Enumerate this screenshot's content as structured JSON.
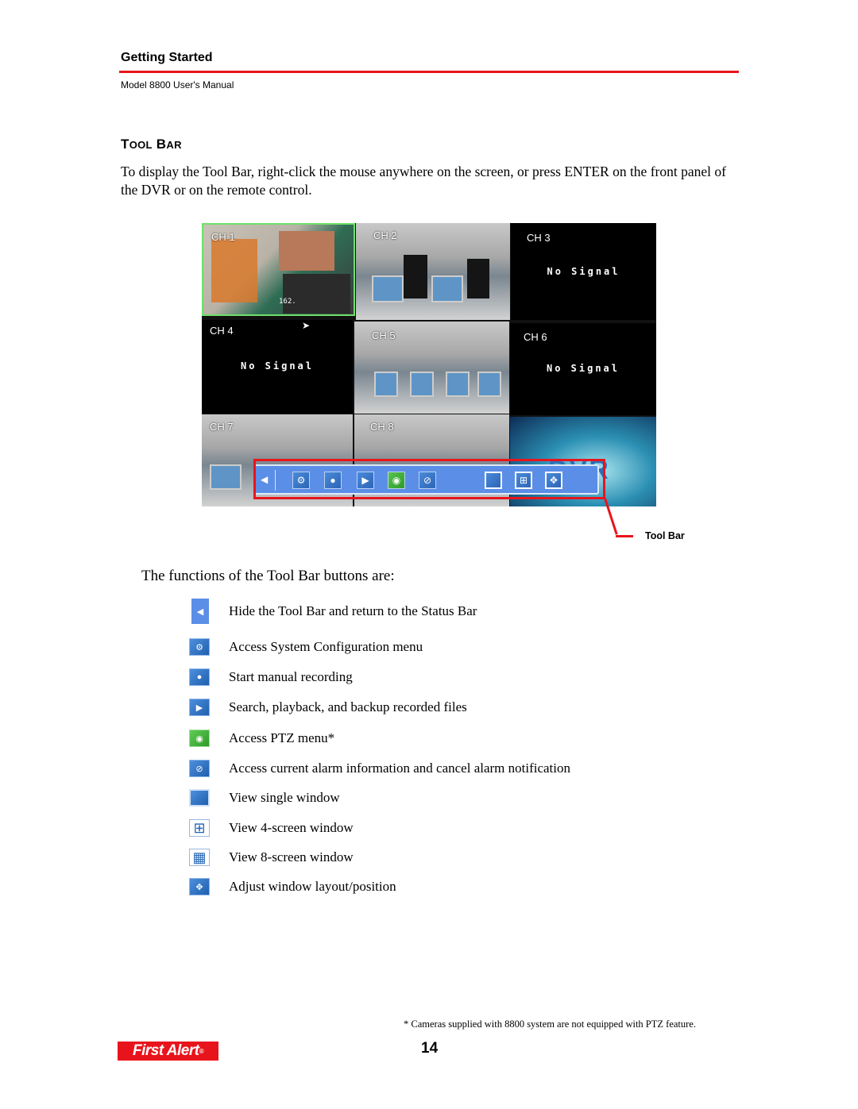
{
  "header": {
    "section": "Getting Started",
    "manual": "Model 8800 User's Manual",
    "rule_color": "#e8141c"
  },
  "section_title": {
    "first_cap": "T",
    "first_rest": "OOL",
    "second_cap": "B",
    "second_rest": "AR"
  },
  "intro": "To display the Tool Bar, right-click the mouse anywhere on the screen, or press ENTER on the front panel of the DVR or on the remote control.",
  "dvr_screen": {
    "channels": [
      {
        "label": "CH 1",
        "status": "video"
      },
      {
        "label": "CH 2",
        "status": "video"
      },
      {
        "label": "CH 3",
        "status": "No Signal"
      },
      {
        "label": "CH 4",
        "status": "No Signal"
      },
      {
        "label": "CH 5",
        "status": "video"
      },
      {
        "label": "CH 6",
        "status": "No Signal"
      },
      {
        "label": "CH 7",
        "status": "video"
      },
      {
        "label": "CH 8",
        "status": "video"
      }
    ],
    "no_signal_text": "No Signal",
    "ch1_overlay": "162.",
    "logo_text": "DVR",
    "toolbar_icons": {
      "back": "◀",
      "config": "⚙",
      "record": "●",
      "play": "▶",
      "ptz": "◉",
      "alarm": "⊘",
      "single": "▢",
      "quad": "⊞",
      "layout": "✥"
    }
  },
  "callout": {
    "label": "Tool Bar",
    "color": "#e8141c"
  },
  "functions_title": "The functions of the Tool Bar buttons are:",
  "functions": [
    {
      "icon": "back-arrow-icon",
      "glyph": "◀",
      "text": "Hide the Tool Bar and return to the Status Bar"
    },
    {
      "icon": "gear-icon",
      "glyph": "⚙",
      "text": "Access System Configuration menu"
    },
    {
      "icon": "record-icon",
      "glyph": "●",
      "text": "Start manual recording"
    },
    {
      "icon": "play-icon",
      "glyph": "▶",
      "text": "Search, playback, and backup recorded files"
    },
    {
      "icon": "ptz-eye-icon",
      "glyph": "◉",
      "text": "Access PTZ menu*"
    },
    {
      "icon": "alarm-icon",
      "glyph": "⊘",
      "text": "Access current alarm information and cancel alarm notification"
    },
    {
      "icon": "single-window-icon",
      "glyph": "",
      "text": "View single window"
    },
    {
      "icon": "four-screen-icon",
      "glyph": "⊞",
      "text": "View 4-screen window"
    },
    {
      "icon": "eight-screen-icon",
      "glyph": "▦",
      "text": "View 8-screen window"
    },
    {
      "icon": "layout-adjust-icon",
      "glyph": "✥",
      "text": "Adjust window layout/position"
    }
  ],
  "footnote": "* Cameras supplied with 8800 system are not equipped with PTZ feature.",
  "footer": {
    "logo": "First Alert",
    "logo_mark": "®",
    "page_number": "14"
  }
}
